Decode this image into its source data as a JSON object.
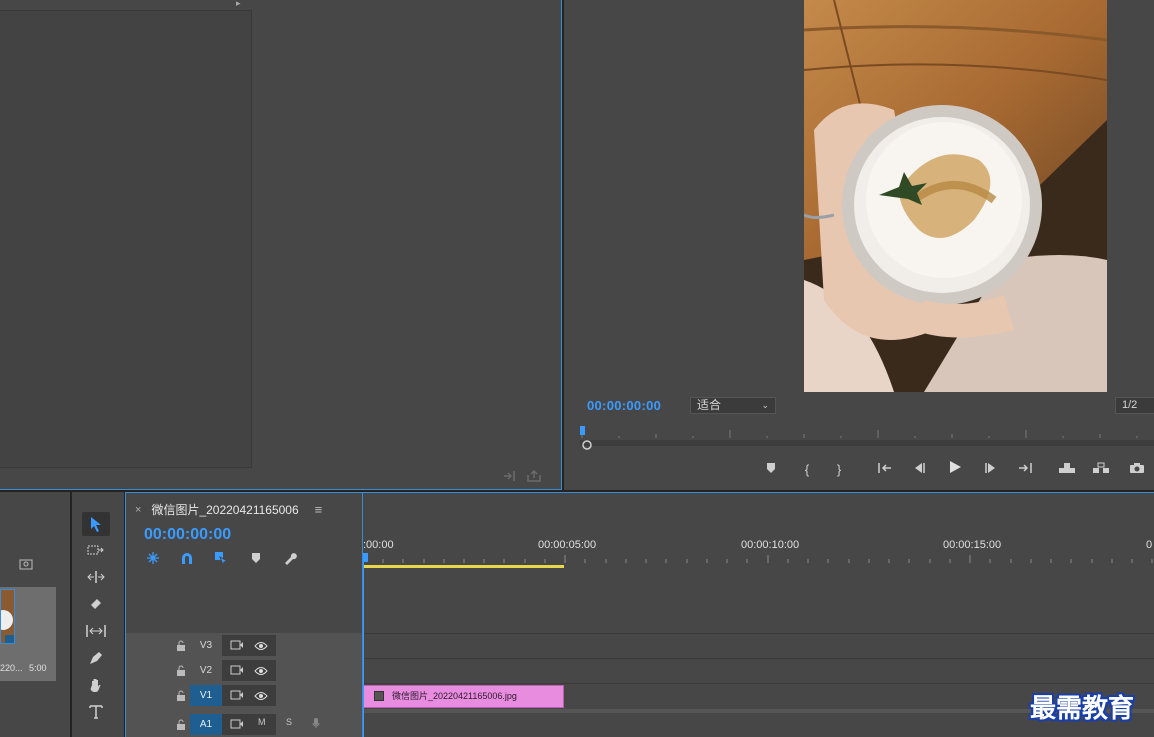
{
  "program_monitor": {
    "timecode": "00:00:00:00",
    "fit_option": "适合",
    "resolution": "1/2"
  },
  "timeline": {
    "tab_title": "微信图片_20220421165006",
    "timecode": "00:00:00:00",
    "ruler_labels": [
      ":00:00",
      "00:00:05:00",
      "00:00:10:00",
      "00:00:15:00",
      "0"
    ],
    "tracks": [
      {
        "name": "V3",
        "type": "video",
        "selected": false
      },
      {
        "name": "V2",
        "type": "video",
        "selected": false
      },
      {
        "name": "V1",
        "type": "video",
        "selected": true
      },
      {
        "name": "A1",
        "type": "audio",
        "selected": true
      }
    ],
    "audio_buttons": {
      "mute": "M",
      "solo": "S"
    },
    "clip": {
      "name": "微信图片_20220421165006.jpg",
      "track": "V1",
      "color": "#e88ce0"
    }
  },
  "project": {
    "item_name": "220...",
    "item_duration": "5:00"
  },
  "watermark": "最需教育",
  "colors": {
    "accent": "#3a9bff",
    "panel": "#474747",
    "clip": "#e88ce0",
    "workbar": "#e9d84a"
  }
}
